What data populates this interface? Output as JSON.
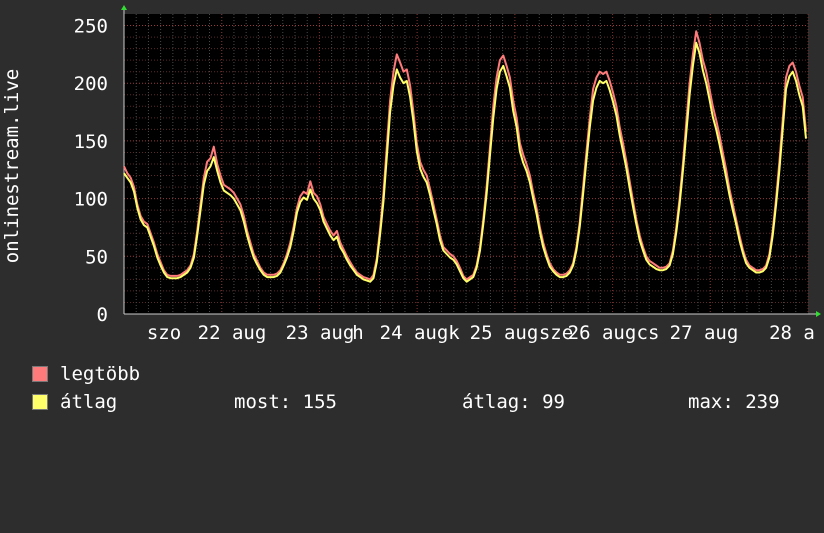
{
  "chart_data": {
    "type": "line",
    "ylabel": "onlinestream.live",
    "ylim": [
      0,
      260
    ],
    "yticks": [
      0,
      50,
      100,
      150,
      200,
      250
    ],
    "grid": true,
    "x_day_labels": [
      "szo",
      "22 aug",
      "23 aug",
      "h",
      "24 aug",
      "k",
      "25 aug",
      "sze",
      "26 aug",
      "cs",
      "27 aug",
      "28 a"
    ],
    "series": [
      {
        "name": "legtöbb",
        "color": "#ff7b7b",
        "values": [
          128,
          122,
          118,
          110,
          95,
          85,
          80,
          78,
          70,
          62,
          52,
          45,
          38,
          34,
          33,
          33,
          33,
          34,
          36,
          38,
          42,
          52,
          72,
          95,
          118,
          132,
          135,
          145,
          130,
          120,
          112,
          110,
          108,
          105,
          100,
          95,
          85,
          72,
          62,
          52,
          46,
          40,
          36,
          34,
          34,
          34,
          35,
          38,
          44,
          52,
          62,
          76,
          92,
          102,
          106,
          104,
          115,
          105,
          102,
          95,
          84,
          78,
          72,
          68,
          72,
          62,
          56,
          50,
          45,
          40,
          36,
          34,
          32,
          31,
          30,
          34,
          48,
          75,
          105,
          145,
          185,
          210,
          225,
          218,
          210,
          212,
          198,
          175,
          148,
          132,
          125,
          120,
          108,
          95,
          82,
          68,
          58,
          55,
          52,
          50,
          46,
          40,
          33,
          30,
          32,
          34,
          42,
          58,
          82,
          110,
          145,
          180,
          205,
          220,
          224,
          215,
          205,
          185,
          170,
          148,
          138,
          130,
          120,
          105,
          92,
          75,
          62,
          52,
          44,
          39,
          36,
          34,
          34,
          35,
          38,
          44,
          58,
          80,
          110,
          140,
          170,
          195,
          205,
          210,
          208,
          210,
          202,
          192,
          180,
          162,
          148,
          132,
          115,
          98,
          82,
          68,
          58,
          50,
          46,
          44,
          42,
          40,
          40,
          41,
          44,
          55,
          75,
          100,
          130,
          165,
          200,
          225,
          245,
          235,
          220,
          210,
          195,
          180,
          168,
          155,
          140,
          125,
          108,
          95,
          82,
          68,
          56,
          47,
          42,
          40,
          38,
          38,
          39,
          42,
          52,
          72,
          100,
          132,
          168,
          205,
          215,
          218,
          210,
          198,
          188,
          158
        ]
      },
      {
        "name": "átlag",
        "color": "#ffff6a",
        "values": [
          122,
          118,
          114,
          106,
          92,
          82,
          77,
          75,
          67,
          59,
          49,
          42,
          36,
          32,
          31,
          31,
          31,
          32,
          34,
          36,
          40,
          49,
          68,
          90,
          112,
          124,
          128,
          136,
          124,
          114,
          107,
          105,
          103,
          100,
          95,
          90,
          80,
          68,
          58,
          49,
          43,
          38,
          34,
          32,
          32,
          32,
          33,
          36,
          42,
          49,
          58,
          72,
          88,
          97,
          101,
          99,
          108,
          100,
          96,
          90,
          80,
          74,
          68,
          64,
          67,
          58,
          53,
          47,
          42,
          38,
          34,
          32,
          30,
          29,
          28,
          31,
          45,
          70,
          98,
          136,
          175,
          198,
          212,
          205,
          200,
          202,
          188,
          167,
          141,
          126,
          119,
          114,
          103,
          90,
          78,
          64,
          55,
          52,
          49,
          47,
          43,
          37,
          31,
          28,
          30,
          32,
          40,
          55,
          78,
          104,
          138,
          170,
          195,
          210,
          215,
          206,
          196,
          176,
          162,
          141,
          131,
          124,
          114,
          100,
          87,
          71,
          58,
          49,
          41,
          37,
          34,
          32,
          32,
          33,
          36,
          42,
          55,
          76,
          104,
          133,
          162,
          185,
          196,
          202,
          200,
          202,
          194,
          184,
          172,
          155,
          141,
          126,
          109,
          93,
          78,
          64,
          55,
          47,
          43,
          41,
          39,
          38,
          38,
          39,
          42,
          52,
          71,
          95,
          124,
          156,
          190,
          215,
          235,
          226,
          211,
          200,
          186,
          171,
          160,
          147,
          133,
          118,
          103,
          90,
          78,
          64,
          53,
          44,
          40,
          38,
          36,
          36,
          37,
          40,
          49,
          68,
          95,
          125,
          160,
          195,
          206,
          210,
          202,
          190,
          180,
          152
        ]
      }
    ],
    "stats": {
      "now_label": "most:",
      "now_value": "155",
      "avg_label": "átlag:",
      "avg_value": "99",
      "max_label": "max:",
      "max_value": "239"
    }
  }
}
